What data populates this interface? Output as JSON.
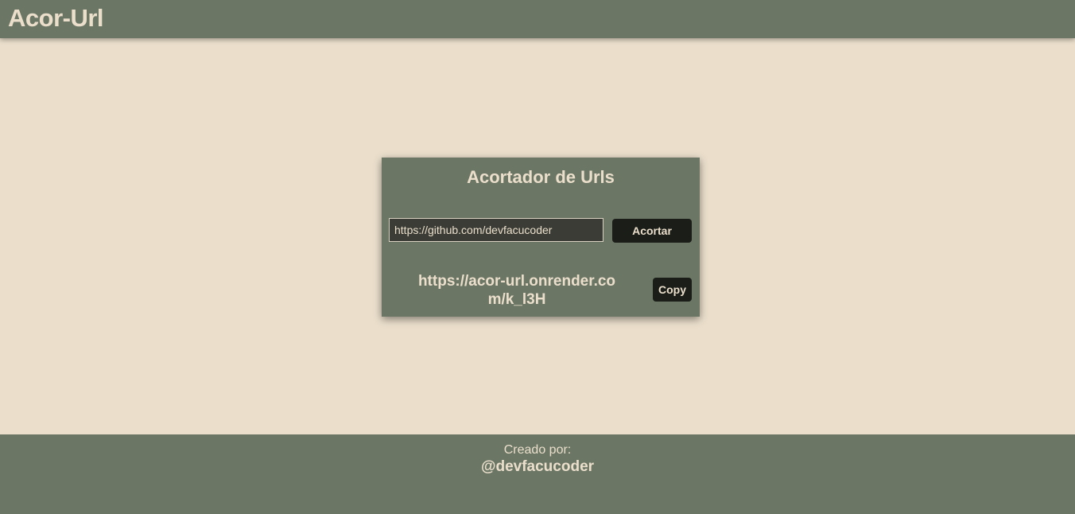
{
  "header": {
    "brand": "Acor-Url"
  },
  "card": {
    "title": "Acortador de Urls",
    "input": {
      "value": "https://github.com/devfacucoder",
      "placeholder": ""
    },
    "shorten_label": "Acortar",
    "result_url": "https://acor-url.onrender.com/k_l3H",
    "copy_label": "Copy"
  },
  "footer": {
    "caption": "Creado por:",
    "handle": "@devfacucoder"
  },
  "colors": {
    "background": "#ebdfcc",
    "panel": "#6b7665",
    "button": "#1b1d18",
    "text": "#ebdfcc"
  }
}
